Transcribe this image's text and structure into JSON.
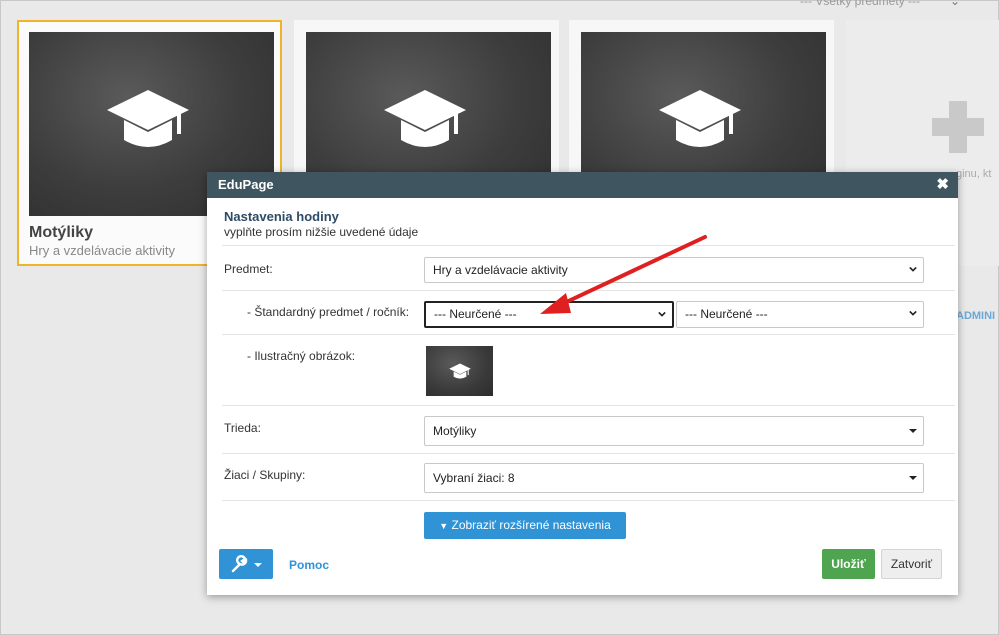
{
  "background": {
    "filter_label": "--- Všetky predmety ---",
    "cards": [
      {
        "title": "Motýliky",
        "subtitle": "Hry a vzdelávacie aktivity"
      },
      {
        "title": "",
        "subtitle": ""
      },
      {
        "title": "",
        "subtitle": ""
      }
    ],
    "side_text": "ginu, kt",
    "admin_text": "ADMINI"
  },
  "modal": {
    "header_title": "EduPage",
    "close_glyph": "✖",
    "title": "Nastavenia hodiny",
    "subtitle": "vyplňte prosím nižšie uvedené údaje",
    "fields": {
      "predmet_label": "Predmet:",
      "predmet_value": "Hry a vzdelávacie aktivity",
      "standard_label": "- Štandardný predmet / ročník:",
      "standard_value": "--- Neurčené ---",
      "rocnik_value": "--- Neurčené ---",
      "image_label": "- Ilustračný obrázok:",
      "trieda_label": "Trieda:",
      "trieda_value": "Motýliky",
      "ziaci_label": "Žiaci / Skupiny:",
      "ziaci_value": "Vybraní žiaci: 8"
    },
    "advanced_button": "Zobraziť rozšírené nastavenia",
    "help_link": "Pomoc",
    "save_button": "Uložiť",
    "close_button": "Zatvoriť"
  },
  "colors": {
    "header_bg": "#3f5660",
    "primary": "#2f93d6",
    "save": "#4fa450",
    "selected_card_border": "#f0b429",
    "annotation_arrow": "#e02020"
  }
}
